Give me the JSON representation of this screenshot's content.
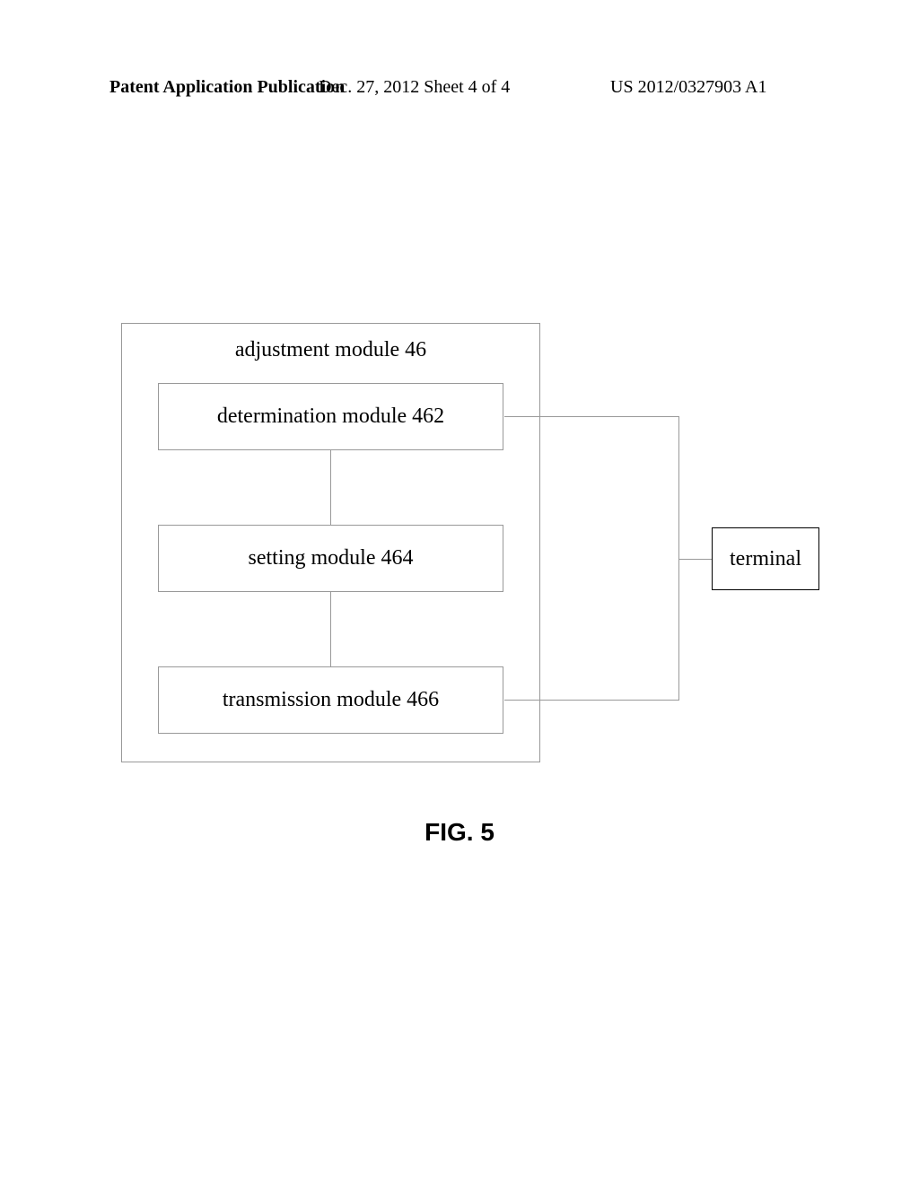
{
  "header": {
    "left": "Patent Application Publication",
    "center": "Dec. 27, 2012  Sheet 4 of 4",
    "right": "US 2012/0327903 A1"
  },
  "diagram": {
    "outer_label": "adjustment module 46",
    "box_462": "determination module 462",
    "box_464": "setting module 464",
    "box_466": "transmission module 466",
    "terminal": "terminal"
  },
  "figure_label": "FIG. 5"
}
